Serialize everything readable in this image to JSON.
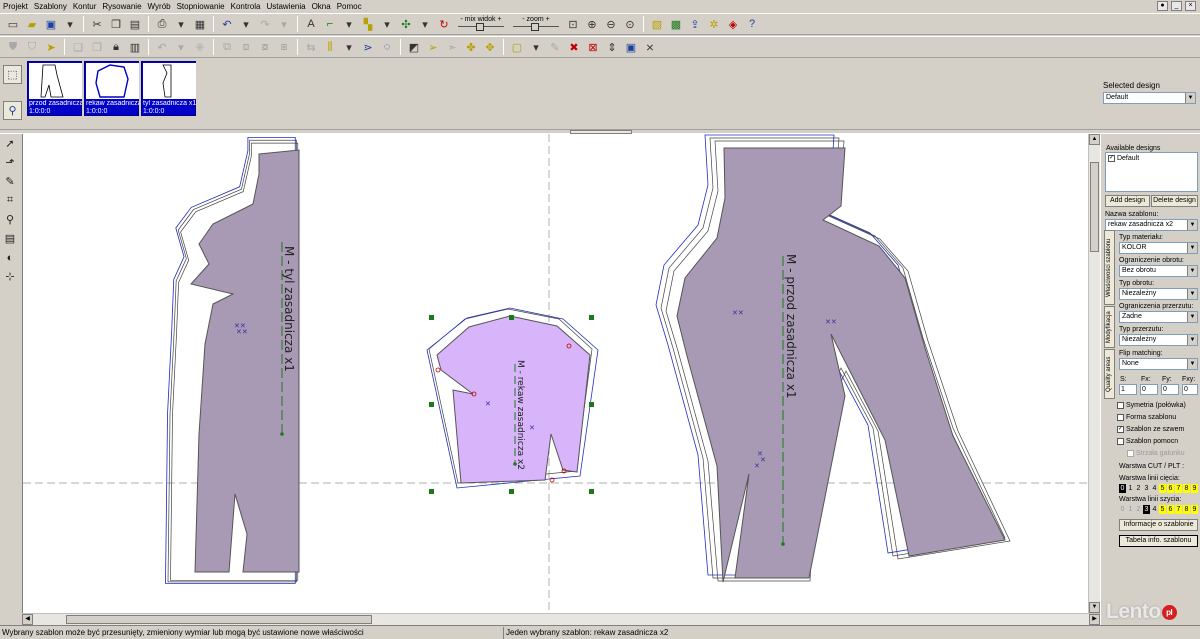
{
  "menu": [
    "Projekt",
    "Szablony",
    "Kontur",
    "Rysowanie",
    "Wyrób",
    "Stopniowanie",
    "Kontrola",
    "Ustawienia",
    "Okna",
    "Pomoc"
  ],
  "toolbar": {
    "mix_view_label": "- mix widok +",
    "zoom_label": "- zoom +"
  },
  "patterns": [
    {
      "label": "przod zasadnicza",
      "scale": "1:0:0:0"
    },
    {
      "label": "rekaw zasadnicza",
      "scale": "1:0:0:0"
    },
    {
      "label": "tyl zasadnicza x1",
      "scale": "1:0:0:0"
    }
  ],
  "selected_design": {
    "label": "Selected design",
    "value": "Default"
  },
  "canvas_labels": {
    "tyl": "M - tyl zasadnicza x1",
    "rekaw": "M - rekaw zasadnicza x2",
    "przod": "M - przod zasadnicza x1"
  },
  "right_panel": {
    "available_designs_label": "Available designs",
    "designs": [
      "Default"
    ],
    "add_design": "Add design",
    "delete_design": "Delete design",
    "nazwa_label": "Nazwa szablonu:",
    "nazwa_value": "rekaw zasadnicza x2",
    "tabs": [
      "Właściwości szablonu",
      "Modyfikacja",
      "Quality areas"
    ],
    "typ_materialu_label": "Typ materiału:",
    "typ_materialu_value": "KOLOR",
    "ograniczenie_obrotu_label": "Ograniczenie obrotu:",
    "ograniczenie_obrotu_value": "Bez obrotu",
    "typ_obrotu_label": "Typ obrotu:",
    "typ_obrotu_value": "Niezależny",
    "ograniczenia_przerzutu_label": "Ograniczenia przerzutu:",
    "ograniczenia_przerzutu_value": "Żadne",
    "typ_przerzutu_label": "Typ przerzutu:",
    "typ_przerzutu_value": "Niezależny",
    "flip_matching_label": "Flip matching:",
    "flip_matching_value": "None",
    "s_label": "S:",
    "s_value": "1",
    "fx_label": "Fx:",
    "fx_value": "0",
    "fy_label": "Fy:",
    "fy_value": "0",
    "fxy_label": "Fxy:",
    "fxy_value": "0",
    "checkboxes": [
      {
        "label": "Symetria (połówka)",
        "checked": false,
        "enabled": true
      },
      {
        "label": "Forma szablonu",
        "checked": false,
        "enabled": true
      },
      {
        "label": "Szablon ze szwem",
        "checked": true,
        "enabled": true
      },
      {
        "label": "Szablon pomocn",
        "checked": false,
        "enabled": true
      },
      {
        "label": "Strzała gatunku",
        "checked": false,
        "enabled": false
      }
    ],
    "warstwa_cut_label": "Warstwa CUT / PLT :",
    "warstwa_ciecia_label": "Warstwa linii cięcia:",
    "warstwa_szycia_label": "Warstwa linii szycia:",
    "layers": [
      "0",
      "1",
      "2",
      "3",
      "4",
      "5",
      "6",
      "7",
      "8",
      "9"
    ],
    "info_btn": "Informacje o szablonie",
    "table_btn": "Tabela info. szablonu"
  },
  "status": {
    "left": "Wybrany szablon może być przesunięty, zmieniony wymiar lub mogą być ustawione nowe właściwości",
    "right": "Jeden wybrany szablon: rekaw zasadnicza x2"
  },
  "watermark": {
    "text": "Lento",
    "suffix": "pl"
  },
  "colors": {
    "piece_fill": "#a89ab5",
    "selected_fill": "#d8b4fa",
    "handle": "#1a7a1a",
    "outline_blue": "#2030c0"
  }
}
